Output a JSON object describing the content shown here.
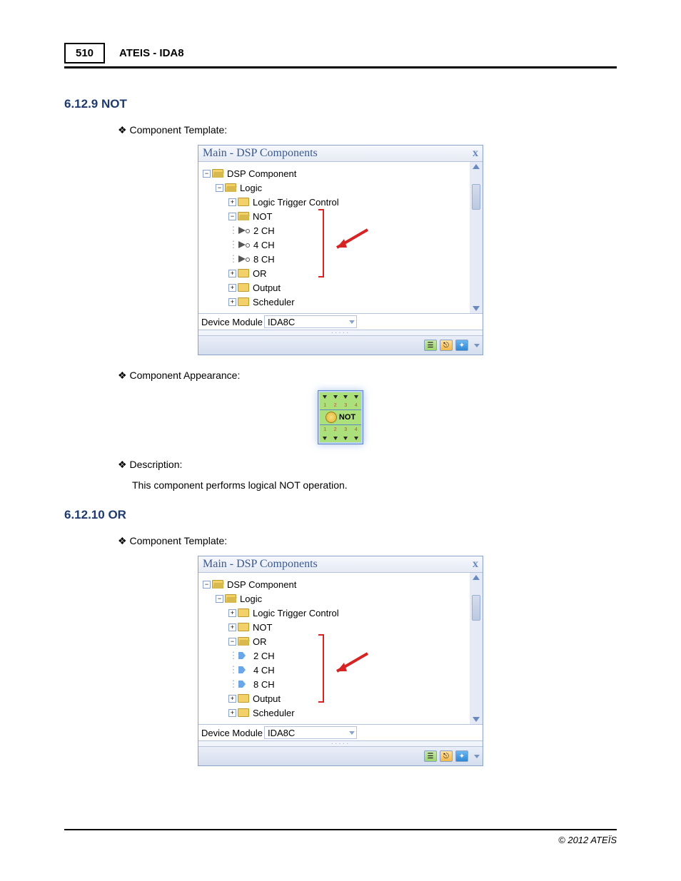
{
  "header": {
    "page_number": "510",
    "title": "ATEIS - IDA8"
  },
  "sections": [
    {
      "num_title": "6.12.9  NOT",
      "template_label": "Component Template:",
      "appearance_label": "Component Appearance:",
      "description_label": "Description:",
      "description_text": "This component performs logical NOT operation.",
      "panel": {
        "title": "Main - DSP Components",
        "close": "x",
        "tree": {
          "root": "DSP Component",
          "logic": "Logic",
          "ltc": "Logic Trigger Control",
          "not_group": "NOT",
          "channels": [
            "2 CH",
            "4 CH",
            "8 CH"
          ],
          "or": "OR",
          "output": "Output",
          "scheduler": "Scheduler"
        },
        "dropdown": {
          "label": "Device Module",
          "value": "IDA8C"
        }
      },
      "component_block": {
        "label": "NOT",
        "numbers": [
          "1",
          "2",
          "3",
          "4"
        ]
      }
    },
    {
      "num_title": "6.12.10 OR",
      "template_label": "Component Template:",
      "panel": {
        "title": "Main - DSP Components",
        "close": "x",
        "tree": {
          "root": "DSP Component",
          "logic": "Logic",
          "ltc": "Logic Trigger Control",
          "not_group": "NOT",
          "or_group": "OR",
          "channels": [
            "2 CH",
            "4 CH",
            "8 CH"
          ],
          "output": "Output",
          "scheduler": "Scheduler"
        },
        "dropdown": {
          "label": "Device Module",
          "value": "IDA8C"
        }
      }
    }
  ],
  "footer": "© 2012 ATEÏS"
}
